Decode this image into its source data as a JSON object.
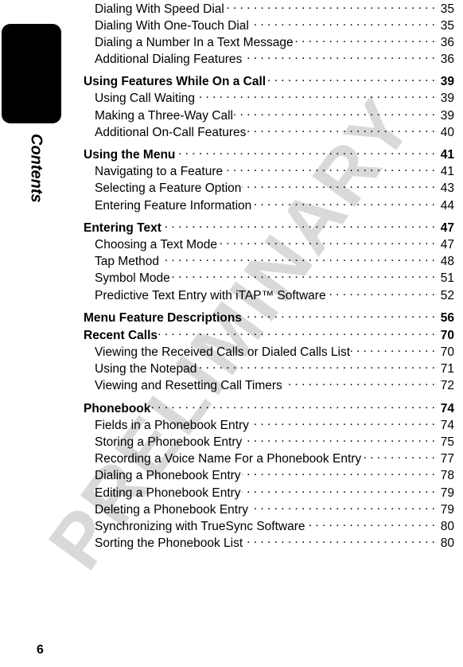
{
  "page": {
    "folio": "6",
    "tab_label": "Contents",
    "watermark": "PRELIMINARY",
    "watermark_color": "#d9d9d9"
  },
  "toc": {
    "entries": [
      {
        "level": 2,
        "title": "Dialing With Speed Dial",
        "page": "35"
      },
      {
        "level": 2,
        "title": "Dialing With One-Touch Dial",
        "page": "35"
      },
      {
        "level": 2,
        "title": "Dialing a Number In a Text Message",
        "page": "36"
      },
      {
        "level": 2,
        "title": "Additional Dialing Features",
        "page": "36"
      },
      {
        "level": 1,
        "title": "Using Features While On a Call",
        "page": "39"
      },
      {
        "level": 2,
        "title": "Using Call Waiting",
        "page": "39"
      },
      {
        "level": 2,
        "title": "Making a Three-Way Call",
        "page": "39"
      },
      {
        "level": 2,
        "title": "Additional On-Call Features",
        "page": "40"
      },
      {
        "level": 1,
        "title": "Using the Menu",
        "page": "41"
      },
      {
        "level": 2,
        "title": "Navigating to a Feature",
        "page": "41"
      },
      {
        "level": 2,
        "title": "Selecting a Feature Option",
        "page": "43"
      },
      {
        "level": 2,
        "title": "Entering Feature Information",
        "page": "44"
      },
      {
        "level": 1,
        "title": "Entering Text",
        "page": "47"
      },
      {
        "level": 2,
        "title": "Choosing a Text Mode",
        "page": "47"
      },
      {
        "level": 2,
        "title": "Tap Method",
        "page": "48"
      },
      {
        "level": 2,
        "title": "Symbol Mode",
        "page": "51"
      },
      {
        "level": 2,
        "title": "Predictive Text Entry with iTAP™ Software",
        "page": "52"
      },
      {
        "level": 1,
        "title": "Menu Feature Descriptions",
        "page": "56"
      },
      {
        "level": 1,
        "title": "Recent Calls",
        "page": "70"
      },
      {
        "level": 2,
        "title": "Viewing the Received Calls or Dialed Calls List",
        "page": "70"
      },
      {
        "level": 2,
        "title": "Using the Notepad",
        "page": "71"
      },
      {
        "level": 2,
        "title": "Viewing and Resetting Call Timers",
        "page": "72"
      },
      {
        "level": 1,
        "title": "Phonebook",
        "page": "74"
      },
      {
        "level": 2,
        "title": "Fields in a Phonebook Entry",
        "page": "74"
      },
      {
        "level": 2,
        "title": "Storing a Phonebook Entry",
        "page": "75"
      },
      {
        "level": 2,
        "title": "Recording a Voice Name For a Phonebook Entry",
        "page": "77"
      },
      {
        "level": 2,
        "title": "Dialing a Phonebook Entry",
        "page": "78"
      },
      {
        "level": 2,
        "title": "Editing a Phonebook Entry",
        "page": "79"
      },
      {
        "level": 2,
        "title": "Deleting a Phonebook Entry",
        "page": "79"
      },
      {
        "level": 2,
        "title": "Synchronizing with TrueSync Software",
        "page": "80"
      },
      {
        "level": 2,
        "title": "Sorting the Phonebook List",
        "page": "80"
      }
    ]
  }
}
